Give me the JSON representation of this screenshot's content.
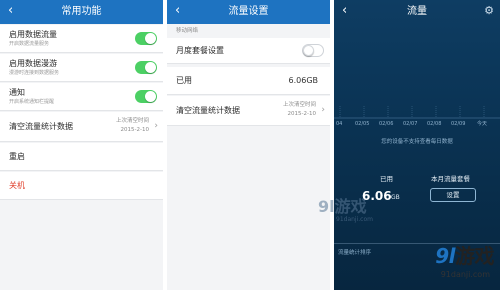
{
  "panel1": {
    "back_icon": "chevron-left-icon",
    "title": "常用功能",
    "rows": [
      {
        "label": "启用数据流量",
        "sub": "开启数据流量服务",
        "toggle": "on"
      },
      {
        "label": "启用数据漫游",
        "sub": "漫游时连接到数据服务",
        "toggle": "on"
      },
      {
        "label": "通知",
        "sub": "开启系统通知栏提醒",
        "toggle": "on"
      }
    ],
    "clear_stats": {
      "label": "清空流量统计数据",
      "note1": "上次清空时间",
      "note2": "2015-2-10"
    },
    "restart": {
      "label": "重启"
    },
    "shutdown": {
      "label": "关机",
      "color": "#e0402c"
    }
  },
  "panel2": {
    "back_icon": "chevron-left-icon",
    "title": "流量设置",
    "section": "移动网络",
    "monthly": {
      "label": "月度套餐设置",
      "toggle": "off"
    },
    "used": {
      "label": "已用",
      "value": "6.06GB"
    },
    "clear_stats": {
      "label": "清空流量统计数据",
      "note1": "上次清空时间",
      "note2": "2015-2-10"
    }
  },
  "panel3": {
    "back_icon": "chevron-left-icon",
    "title": "流量",
    "settings_icon": "gear-icon",
    "ticks": [
      "04",
      "02/05",
      "02/06",
      "02/07",
      "02/08",
      "02/09",
      "今天"
    ],
    "note": "您的设备不支持查看每日数据",
    "used_label": "已用",
    "used_value": "6.06",
    "used_unit": "GB",
    "plan_label": "本月流量套餐",
    "set_button": "设置",
    "bottom_label": "流量统计排序"
  },
  "watermark": {
    "brand_num": "9l",
    "brand_text": "游戏",
    "url": "91danji.com"
  },
  "colors": {
    "topbar": "#1e73c1",
    "toggle_on": "#4cd064",
    "dark_bg": "#0a3252",
    "danger": "#e0402c"
  }
}
